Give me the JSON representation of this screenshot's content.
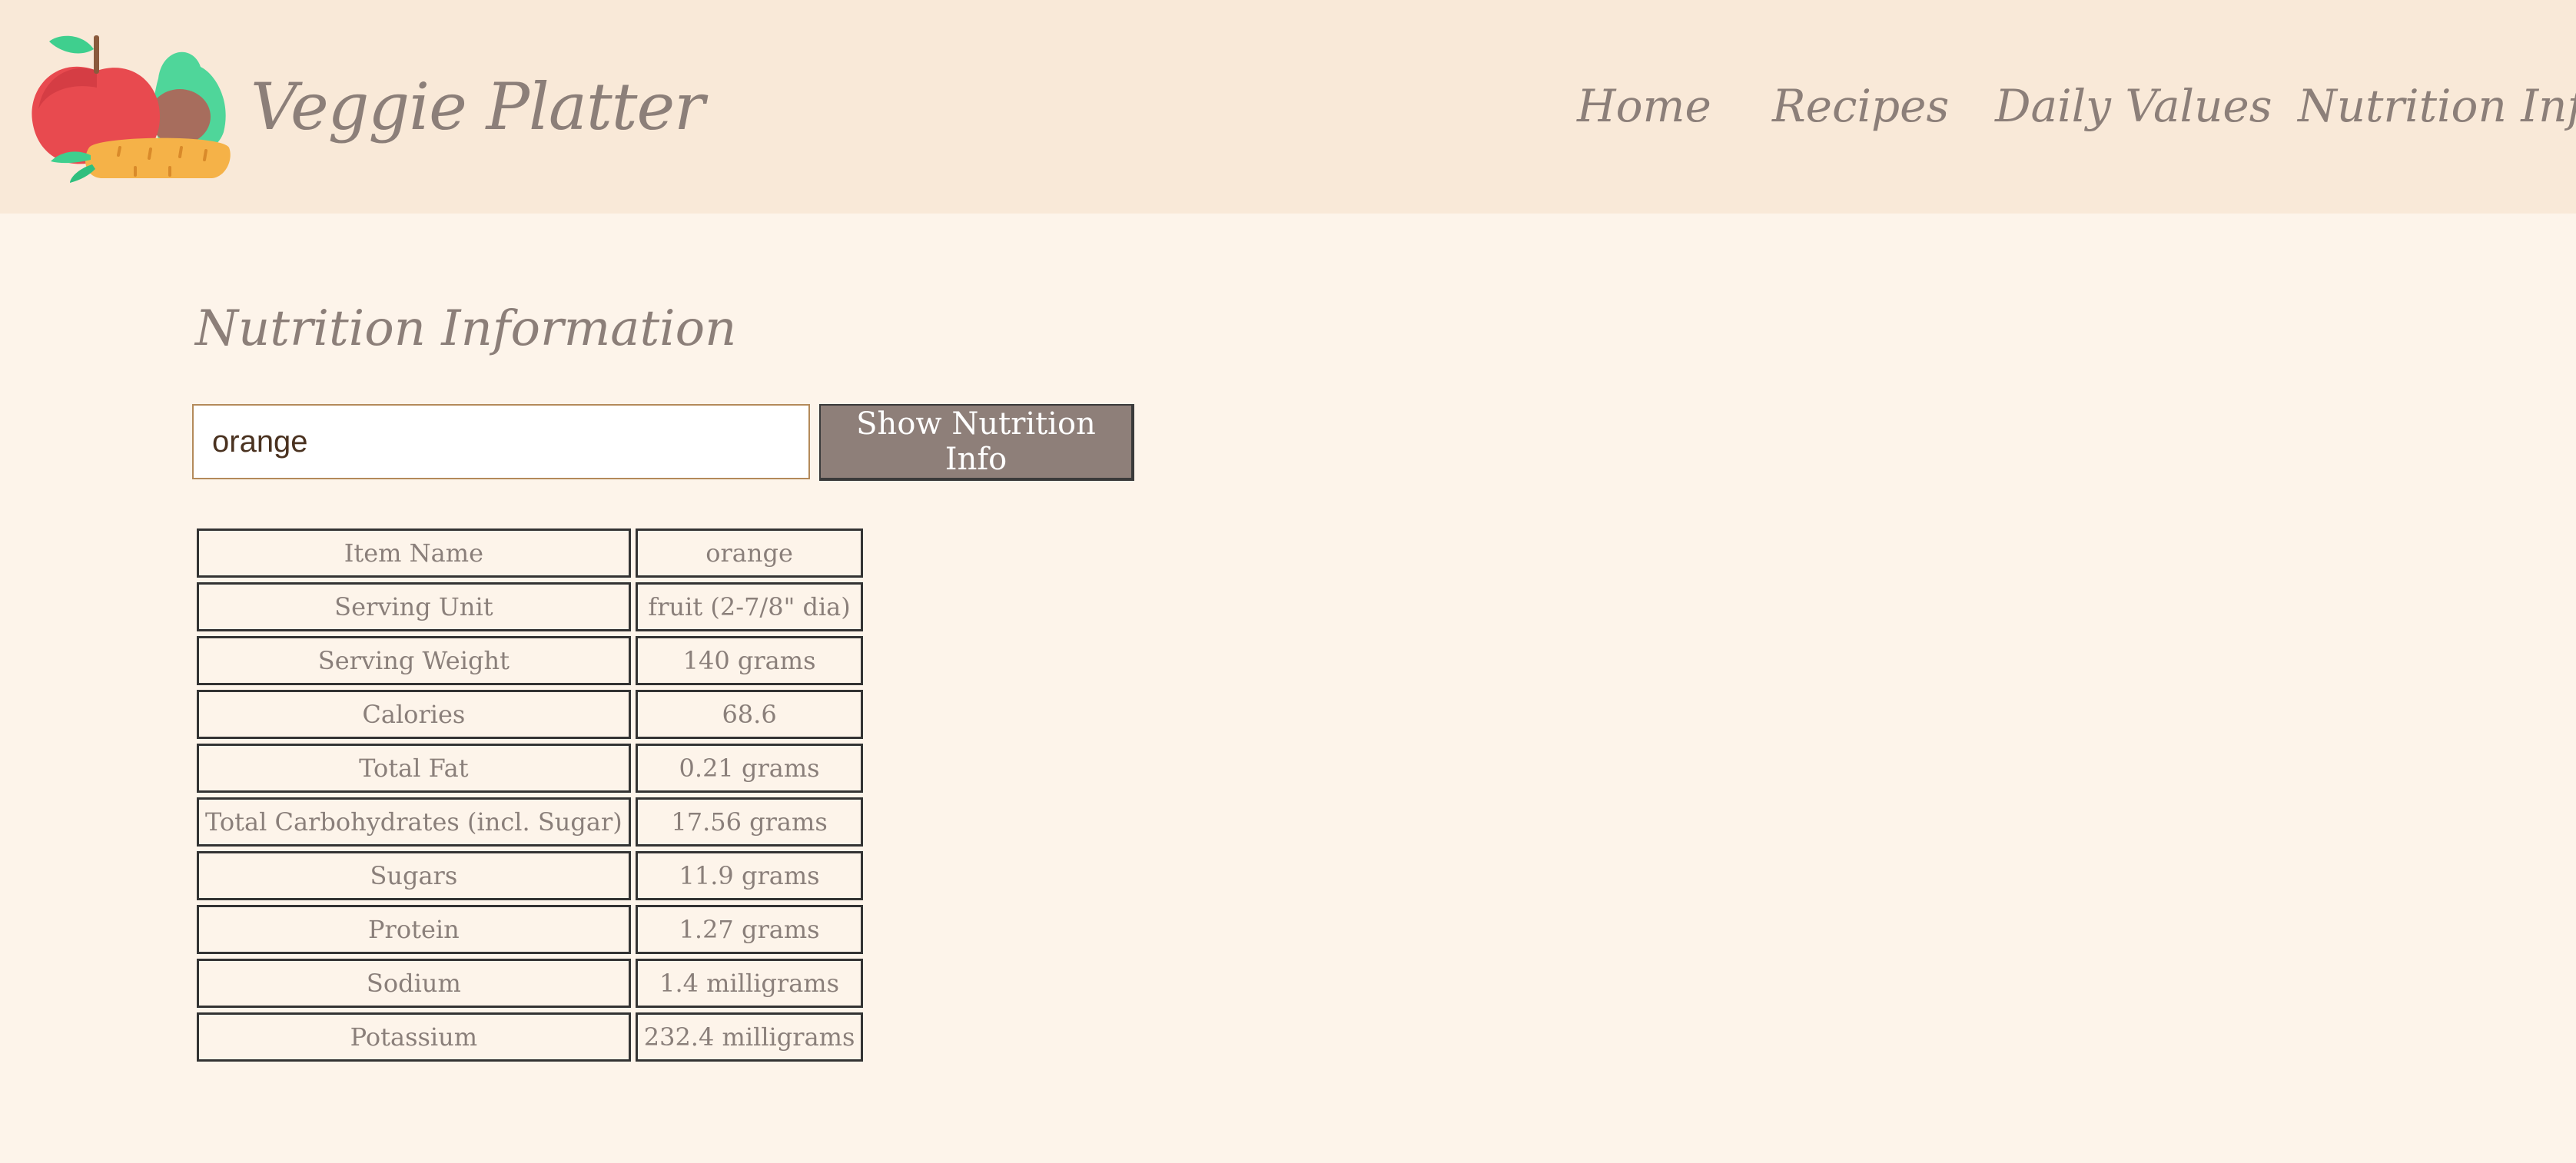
{
  "header": {
    "brand": "Veggie Platter",
    "logo_icon": "fruit-vegetable-logo",
    "nav": [
      "Home",
      "Recipes",
      "Daily Values",
      "Nutrition Info"
    ]
  },
  "main": {
    "title": "Nutrition Information",
    "search": {
      "value": "orange",
      "placeholder": ""
    },
    "button_label": "Show Nutrition Info",
    "table": {
      "rows": [
        {
          "label": "Item Name",
          "value": "orange"
        },
        {
          "label": "Serving Unit",
          "value": "fruit (2-7/8\" dia)"
        },
        {
          "label": "Serving Weight",
          "value": "140 grams"
        },
        {
          "label": "Calories",
          "value": "68.6"
        },
        {
          "label": "Total Fat",
          "value": "0.21 grams"
        },
        {
          "label": "Total Carbohydrates (incl. Sugar)",
          "value": "17.56 grams"
        },
        {
          "label": "Sugars",
          "value": "11.9 grams"
        },
        {
          "label": "Protein",
          "value": "1.27 grams"
        },
        {
          "label": "Sodium",
          "value": "1.4 milligrams"
        },
        {
          "label": "Potassium",
          "value": "232.4 milligrams"
        }
      ]
    }
  },
  "colors": {
    "header_bg": "#f9e9d8",
    "page_bg": "#fdf4ea",
    "text": "#8c7f79",
    "button_bg": "#8e7f79"
  }
}
